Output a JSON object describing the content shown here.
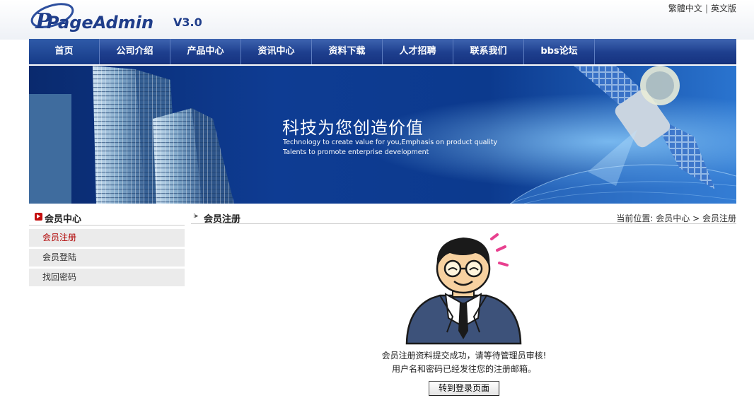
{
  "header": {
    "logo_text": "PageAdmin",
    "version": "V3.0",
    "lang_links": [
      "繁體中文",
      "英文版"
    ],
    "lang_separator": "|"
  },
  "nav": {
    "items": [
      "首页",
      "公司介绍",
      "产品中心",
      "资讯中心",
      "资料下载",
      "人才招聘",
      "联系我们",
      "bbs论坛"
    ],
    "active": "首页"
  },
  "banner": {
    "title": "科技为您创造价值",
    "subtitle_line1": "Technology to create value for you,Emphasis on product quality",
    "subtitle_line2": "Talents to promote enterprise development"
  },
  "sidebar": {
    "title": "会员中心",
    "items": [
      "会员注册",
      "会员登陆",
      "找回密码"
    ],
    "active": "会员注册"
  },
  "main": {
    "title": "会员注册",
    "breadcrumb_prefix": "当前位置:",
    "breadcrumb_home": "会员中心",
    "breadcrumb_sep": ">",
    "breadcrumb_current": "会员注册",
    "message_line1": "会员注册资料提交成功，请等待管理员审核!",
    "message_line2": "用户名和密码已经发往您的注册邮箱。",
    "button_label": "转到登录页面"
  },
  "colors": {
    "nav_blue": "#1e3f8e",
    "banner_blue": "#0b3a88",
    "side_active": "#b00000",
    "side_bg": "#ebebeb"
  }
}
